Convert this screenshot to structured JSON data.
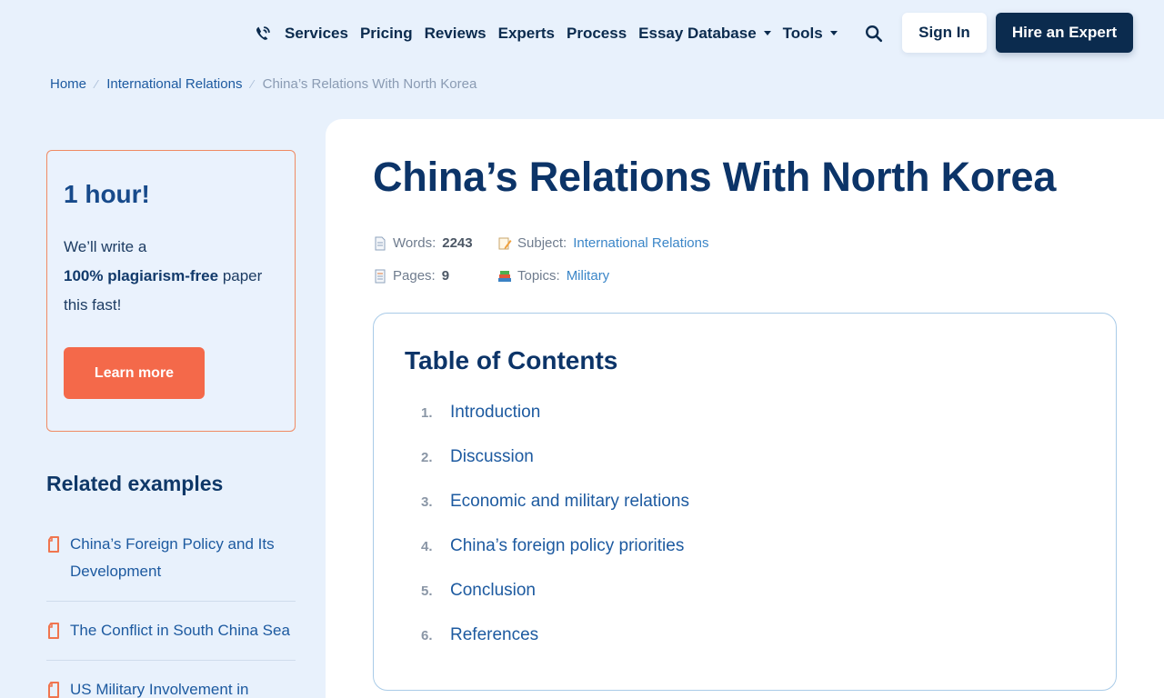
{
  "nav": {
    "links": [
      "Services",
      "Pricing",
      "Reviews",
      "Experts",
      "Process",
      "Essay Database",
      "Tools"
    ],
    "sign_in": "Sign In",
    "hire": "Hire an Expert"
  },
  "breadcrumb": {
    "home": "Home",
    "category": "International Relations",
    "current": "China’s Relations With North Korea"
  },
  "promo": {
    "title": "1 hour!",
    "line1": "We’ll write a",
    "bold": "100% plagiarism-free",
    "line2": " paper",
    "line3": "this fast!",
    "button": "Learn more"
  },
  "related": {
    "title": "Related examples",
    "items": [
      "China’s Foreign Policy and Its Development",
      "The Conflict in South China Sea",
      "US Military Involvement in"
    ]
  },
  "article": {
    "title": "China’s Relations With North Korea",
    "words_label": "Words:",
    "words": "2243",
    "pages_label": "Pages:",
    "pages": "9",
    "subject_label": "Subject:",
    "subject": "International Relations",
    "topics_label": "Topics:",
    "topics": "Military"
  },
  "toc": {
    "title": "Table of Contents",
    "items": [
      {
        "num": "1.",
        "label": "Introduction"
      },
      {
        "num": "2.",
        "label": "Discussion"
      },
      {
        "num": "3.",
        "label": "Economic and military relations"
      },
      {
        "num": "4.",
        "label": "China’s foreign policy priorities"
      },
      {
        "num": "5.",
        "label": "Conclusion"
      },
      {
        "num": "6.",
        "label": "References"
      }
    ]
  },
  "colors": {
    "navy": "#0b2b4e",
    "accent_orange": "#f4694a",
    "link_blue": "#1d5aa0",
    "background": "#e8f1fc"
  }
}
